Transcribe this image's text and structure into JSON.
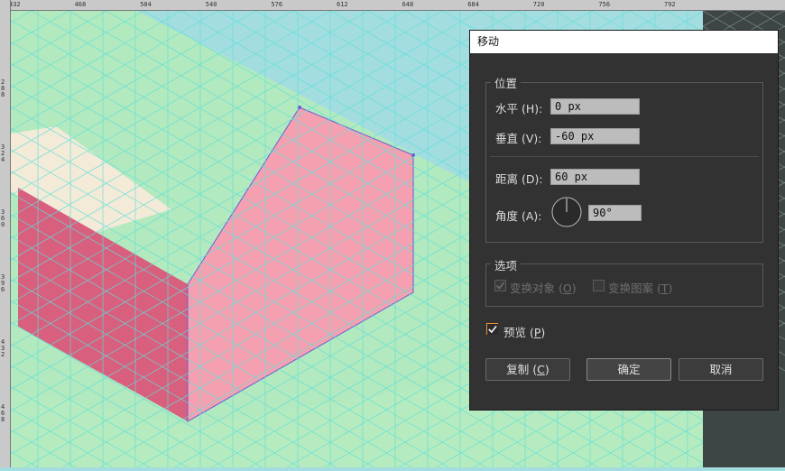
{
  "ruler_top": [
    "432",
    "468",
    "504",
    "540",
    "576",
    "612",
    "648",
    "684",
    "720",
    "756",
    "792"
  ],
  "ruler_left": [
    "288",
    "324",
    "360",
    "396",
    "432",
    "468"
  ],
  "dialog": {
    "title": "移动",
    "position_group": "位置",
    "horizontal_label": "水平 (H):",
    "horizontal_value": "0 px",
    "vertical_label": "垂直 (V):",
    "vertical_value": "-60 px",
    "distance_label": "距离 (D):",
    "distance_value": "60 px",
    "angle_label": "角度 (A):",
    "angle_value": "90°",
    "options_group": "选项",
    "transform_objects": {
      "pre": "变换对象 (",
      "key": "O",
      "post": ")",
      "checked": true,
      "enabled": false
    },
    "transform_patterns": {
      "pre": "变换图案 (",
      "key": "T",
      "post": ")",
      "checked": false,
      "enabled": false
    },
    "preview": {
      "pre": "预览 (",
      "key": "P",
      "post": ")",
      "checked": true
    },
    "copy_button": {
      "pre": "复制 (",
      "key": "C",
      "post": ")"
    },
    "ok_button": "确定",
    "cancel_button": "取消"
  },
  "colors": {
    "canvas_bg": "#a3dde0",
    "floor": "#b2e9be",
    "grid_line": "#5fe0d8",
    "pink_face": "#f5a0b0",
    "dark_pink_face": "#d85f7e",
    "cream_face": "#f3ead8",
    "dialog_bg": "#323232",
    "accent_check": "#e8943a"
  }
}
